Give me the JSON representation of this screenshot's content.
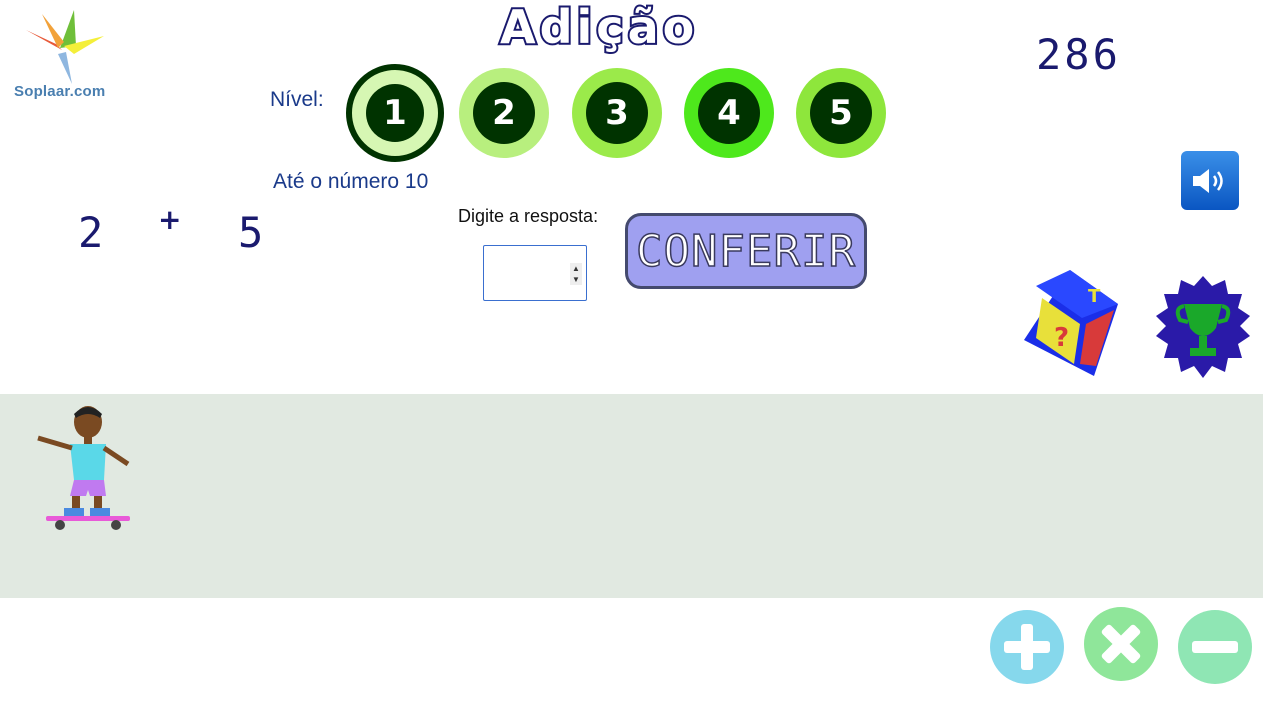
{
  "logo": {
    "text": "Soplaar.com",
    "icon": "pinwheel-icon"
  },
  "title": "Adição",
  "score": "286",
  "level": {
    "label": "Nível:",
    "selected": 1,
    "options": [
      "1",
      "2",
      "3",
      "4",
      "5"
    ],
    "range_label": "Até o número 10"
  },
  "problem": {
    "a": "2",
    "operator": "+",
    "b": "5"
  },
  "answer": {
    "label": "Digite a resposta:",
    "value": ""
  },
  "check_button": "CONFERIR",
  "icons": {
    "sound": "speaker-icon",
    "dice": "dice-icon",
    "trophy": "trophy-icon",
    "skater": "skateboarder-icon"
  },
  "operations": [
    "add",
    "multiply",
    "subtract"
  ],
  "colors": {
    "title_stroke": "#1a1a6e",
    "level_dark": "#003300",
    "check_button": "#9fa0f0",
    "track": "#e1e9e1",
    "op_add": "#86d8ec",
    "op_mul": "#8fe69a",
    "op_sub": "#8fe6b4"
  }
}
